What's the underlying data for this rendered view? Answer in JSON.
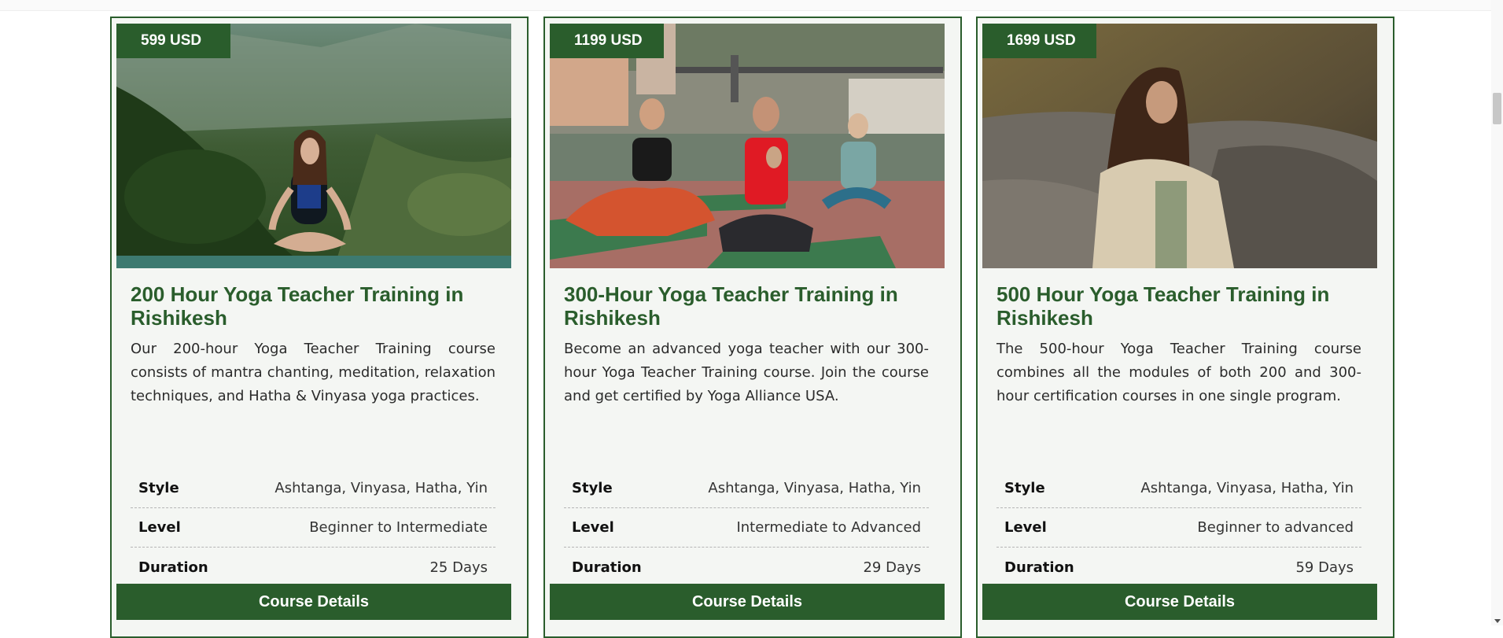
{
  "courses": [
    {
      "price": "599 USD",
      "title": "200 Hour Yoga Teacher Training in Rishikesh",
      "description": "Our 200-hour Yoga Teacher Training course consists of mantra chanting, meditation, relaxation techniques, and Hatha & Vinyasa yoga practices.",
      "details": [
        {
          "label": "Style",
          "value": "Ashtanga, Vinyasa, Hatha, Yin"
        },
        {
          "label": "Level",
          "value": "Beginner to Intermediate"
        },
        {
          "label": "Duration",
          "value": "25 Days"
        }
      ],
      "button_label": "Course Details"
    },
    {
      "price": "1199 USD",
      "title": "300-Hour Yoga Teacher Training in Rishikesh",
      "description": "Become an advanced yoga teacher with our 300-hour Yoga Teacher Training course. Join the course and get certified by Yoga Alliance USA.",
      "details": [
        {
          "label": "Style",
          "value": "Ashtanga, Vinyasa, Hatha, Yin"
        },
        {
          "label": "Level",
          "value": "Intermediate to Advanced"
        },
        {
          "label": "Duration",
          "value": "29 Days"
        }
      ],
      "button_label": "Course Details"
    },
    {
      "price": "1699 USD",
      "title": "500 Hour Yoga Teacher Training in Rishikesh",
      "description": "The 500-hour Yoga Teacher Training course combines all the modules of both 200 and 300-hour certification courses in one single program.",
      "details": [
        {
          "label": "Style",
          "value": "Ashtanga, Vinyasa, Hatha, Yin"
        },
        {
          "label": "Level",
          "value": "Beginner to advanced"
        },
        {
          "label": "Duration",
          "value": "59 Days"
        }
      ],
      "button_label": "Course Details"
    }
  ],
  "colors": {
    "brand_green": "#2a5d2c",
    "card_background": "#f4f6f3"
  }
}
